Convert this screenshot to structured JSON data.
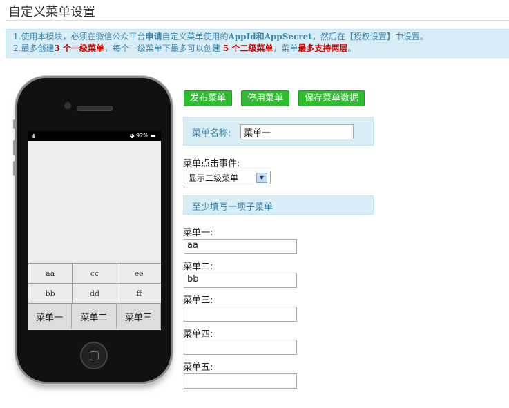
{
  "page_title": "自定义菜单设置",
  "notice": {
    "l1_a": "1.使用本模块，必须在微信公众平台",
    "l1_b": "申请",
    "l1_c": "自定义菜单使用的",
    "l1_d": "AppId",
    "l1_e": "和",
    "l1_f": "AppSecret",
    "l1_g": "，然后在【授权设置】中设置。",
    "l2_a": "2.最多创建",
    "l2_b": "3 个一级菜单",
    "l2_c": "，每个一级菜单下最多可以创建 ",
    "l2_d": "5 个二级菜单",
    "l2_e": "，菜单",
    "l2_f": "最多支持两层",
    "l2_g": "。"
  },
  "phone": {
    "signal": "ıll",
    "battery": "◕ 92% ▬",
    "submenu_rows": [
      [
        "aa",
        "cc",
        "ee"
      ],
      [
        "bb",
        "dd",
        "ff"
      ]
    ],
    "main_menus": [
      "菜单一",
      "菜单二",
      "菜单三"
    ]
  },
  "buttons": {
    "publish": "发布菜单",
    "stop": "停用菜单",
    "save": "保存菜单数据"
  },
  "menu_name": {
    "label": "菜单名称:",
    "value": "菜单一"
  },
  "click_event": {
    "label": "菜单点击事件:",
    "selected": "显示二级菜单"
  },
  "hint": "至少填写一项子菜单",
  "submenus": [
    {
      "label": "菜单一:",
      "value": "aa"
    },
    {
      "label": "菜单二:",
      "value": "bb"
    },
    {
      "label": "菜单三:",
      "value": ""
    },
    {
      "label": "菜单四:",
      "value": ""
    },
    {
      "label": "菜单五:",
      "value": ""
    }
  ]
}
